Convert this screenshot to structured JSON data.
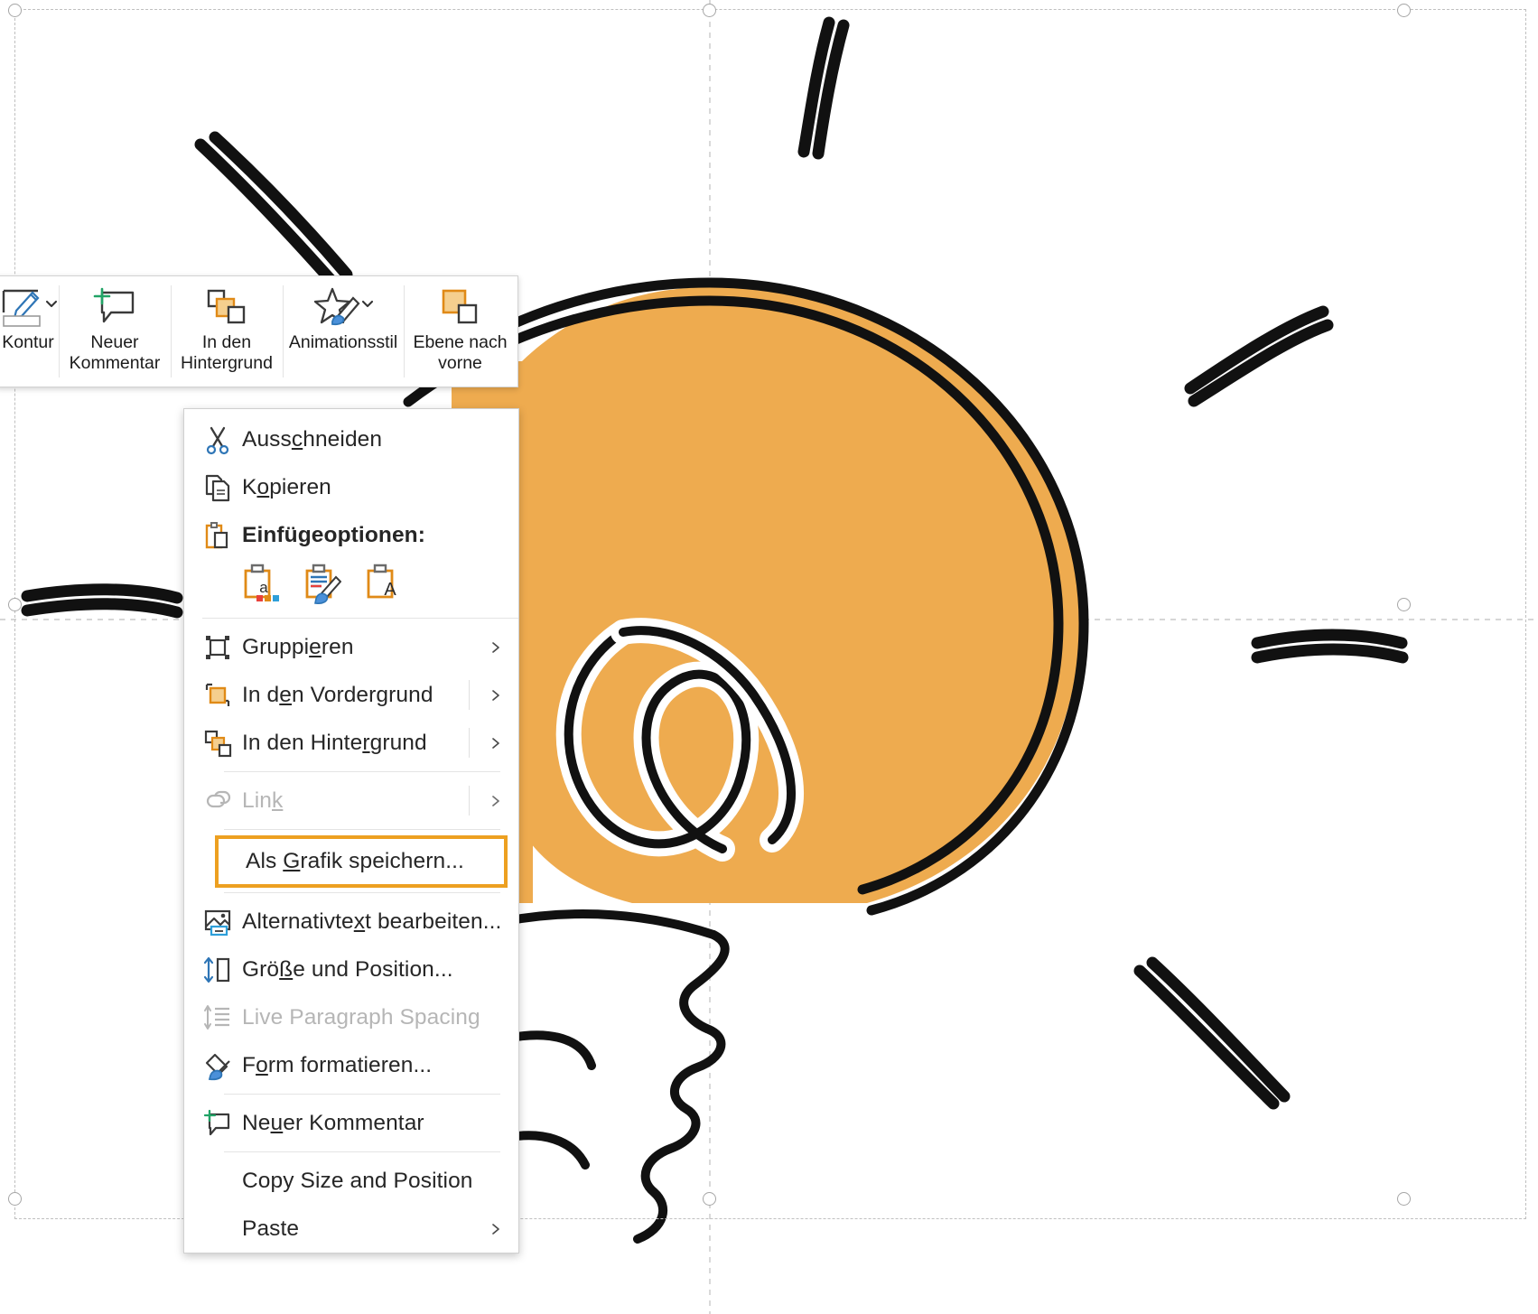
{
  "app": {
    "surface": "powerpoint-slide-editing-canvas",
    "selection_color": "#a6a6a6",
    "accent_orange": "#eda021",
    "shape_fill": "#eeab4f"
  },
  "mini_toolbar": {
    "items": [
      {
        "label": "Kontur",
        "icon": "shape-outline-icon",
        "has_dropdown": true
      },
      {
        "label": "Neuer\nKommentar",
        "icon": "new-comment-icon",
        "has_dropdown": false
      },
      {
        "label": "In den\nHintergrund",
        "icon": "send-to-back-icon",
        "has_dropdown": false
      },
      {
        "label": "Animationsstil",
        "icon": "animation-style-icon",
        "has_dropdown": true
      },
      {
        "label": "Ebene nach\nvorne",
        "icon": "bring-forward-icon",
        "has_dropdown": false
      }
    ]
  },
  "context_menu": {
    "items": [
      {
        "id": "cut",
        "label": "Ausschneiden",
        "accel": "c",
        "icon": "scissors-icon",
        "disabled": false,
        "submenu": false,
        "bold": false
      },
      {
        "id": "copy",
        "label": "Kopieren",
        "accel": "o",
        "icon": "copy-icon",
        "disabled": false,
        "submenu": false,
        "bold": false
      },
      {
        "id": "paste-options",
        "label": "Einfügeoptionen:",
        "accel": "",
        "icon": "clipboard-icon",
        "disabled": false,
        "submenu": false,
        "bold": true
      },
      {
        "id": "group",
        "label": "Gruppieren",
        "accel": "i",
        "icon": "group-icon",
        "disabled": false,
        "submenu": true,
        "bold": false
      },
      {
        "id": "bring-to-front",
        "label": "In den Vordergrund",
        "accel": "e",
        "icon": "bring-to-front-icon",
        "disabled": false,
        "submenu": true,
        "bold": false
      },
      {
        "id": "send-to-back",
        "label": "In den Hintergrund",
        "accel": "r",
        "icon": "send-to-back-icon",
        "disabled": false,
        "submenu": true,
        "bold": false
      },
      {
        "id": "link",
        "label": "Link",
        "accel": "k",
        "icon": "link-icon",
        "disabled": true,
        "submenu": true,
        "bold": false
      },
      {
        "id": "save-as-picture",
        "label": "Als Grafik speichern...",
        "accel": "G",
        "icon": "",
        "disabled": false,
        "submenu": false,
        "bold": false,
        "highlighted": true
      },
      {
        "id": "edit-alt-text",
        "label": "Alternativtext bearbeiten...",
        "accel": "x",
        "icon": "alt-text-icon",
        "disabled": false,
        "submenu": false,
        "bold": false
      },
      {
        "id": "size-and-position",
        "label": "Größe und Position...",
        "accel": "ß",
        "icon": "size-position-icon",
        "disabled": false,
        "submenu": false,
        "bold": false
      },
      {
        "id": "live-paragraph-spacing",
        "label": "Live Paragraph Spacing",
        "accel": "",
        "icon": "paragraph-spacing-icon",
        "disabled": true,
        "submenu": false,
        "bold": false
      },
      {
        "id": "format-shape",
        "label": "Form formatieren...",
        "accel": "o",
        "icon": "format-shape-icon",
        "disabled": false,
        "submenu": false,
        "bold": false
      },
      {
        "id": "new-comment",
        "label": "Neuer Kommentar",
        "accel": "u",
        "icon": "new-comment-icon",
        "disabled": false,
        "submenu": false,
        "bold": false
      },
      {
        "id": "copy-size-and-position",
        "label": "Copy Size and Position",
        "accel": "",
        "icon": "",
        "disabled": false,
        "submenu": false,
        "bold": false
      },
      {
        "id": "paste",
        "label": "Paste",
        "accel": "",
        "icon": "",
        "disabled": false,
        "submenu": true,
        "bold": false
      }
    ],
    "paste_options": [
      {
        "id": "keep-source-formatting",
        "name": "paste-keep-source-formatting-icon"
      },
      {
        "id": "use-destination-theme",
        "name": "paste-use-destination-theme-icon"
      },
      {
        "id": "keep-text-only",
        "name": "paste-keep-text-only-icon"
      }
    ]
  }
}
